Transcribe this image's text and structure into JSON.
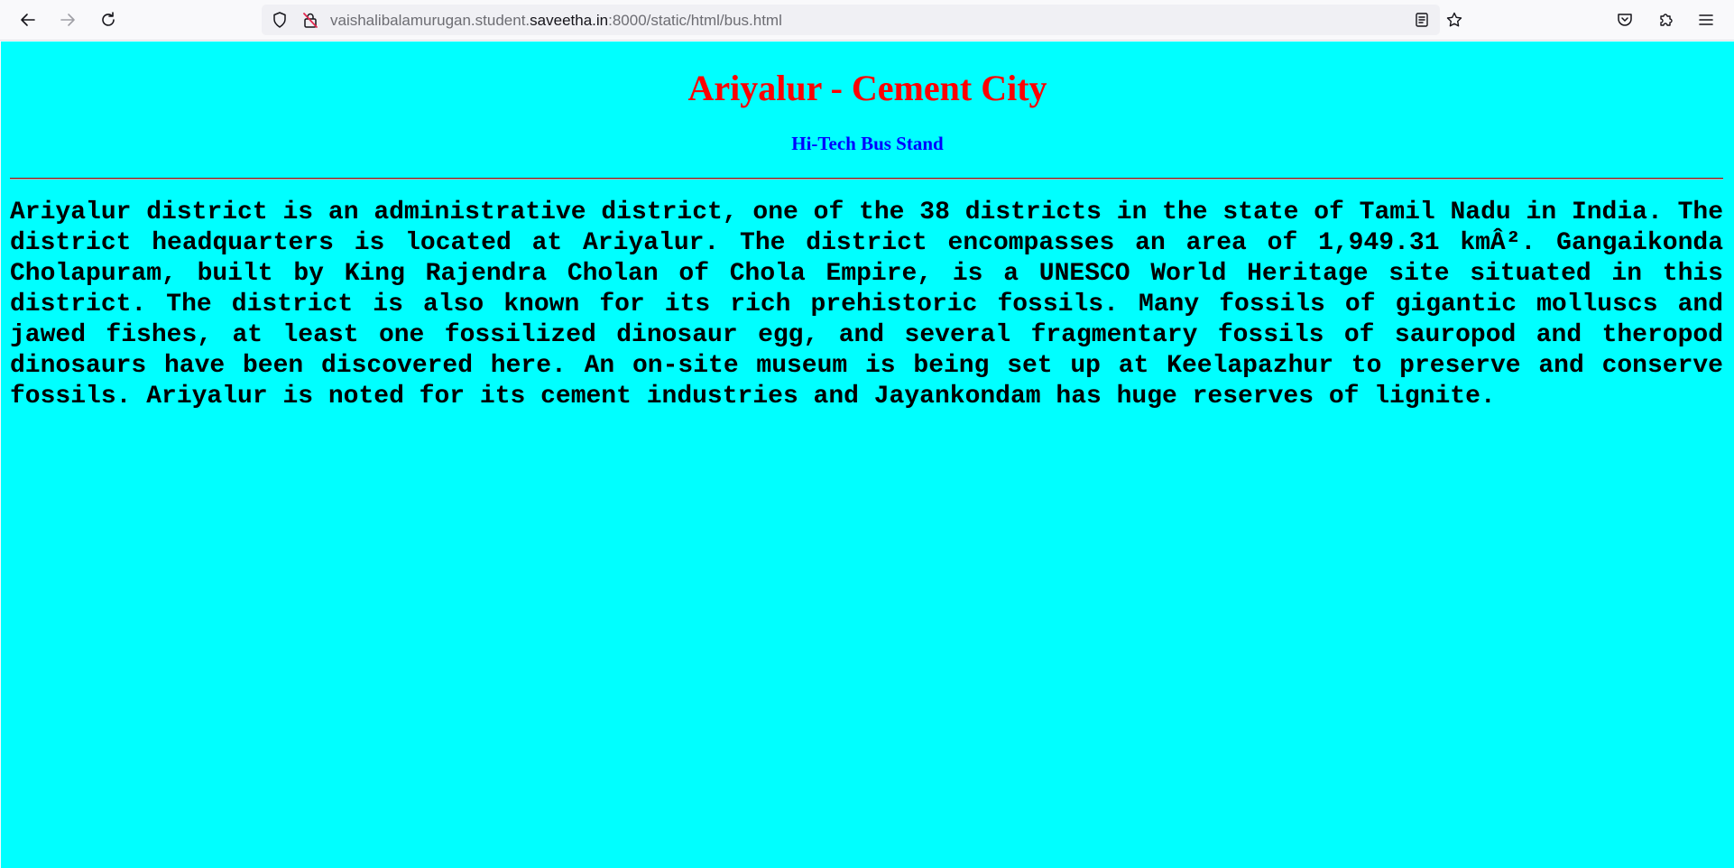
{
  "browser": {
    "url_prefix": "vaishalibalamurugan.student.",
    "url_host": "saveetha.in",
    "url_suffix": ":8000/static/html/bus.html",
    "icons": {
      "back": "back-arrow-icon",
      "forward": "forward-arrow-icon",
      "reload": "reload-icon",
      "tracking": "shield-icon",
      "security": "insecure-lock-icon",
      "reader": "reader-view-icon",
      "bookmark": "star-icon",
      "pocket": "pocket-icon",
      "extensions": "puzzle-icon",
      "menu": "hamburger-menu-icon"
    }
  },
  "page": {
    "background": "#00ffff",
    "title": "Ariyalur - Cement City",
    "title_color": "#ff0000",
    "subtitle": "Hi-Tech Bus Stand",
    "subtitle_color": "#0000ff",
    "paragraph": "Ariyalur district is an administrative district, one of the 38 districts in the state of Tamil Nadu in India. The district headquarters is located at Ariyalur. The district encompasses an area of 1,949.31 kmÂ². Gangaikonda Cholapuram, built by King Rajendra Cholan of Chola Empire, is a UNESCO World Heritage site situated in this district. The district is also known for its rich prehistoric fossils. Many fossils of gigantic molluscs and jawed fishes, at least one fossilized dinosaur egg, and several fragmentary fossils of sauropod and theropod dinosaurs have been discovered here. An on-site museum is being set up at Keelapazhur to preserve and conserve fossils. Ariyalur is noted for its cement industries and Jayankondam has huge reserves of lignite."
  }
}
